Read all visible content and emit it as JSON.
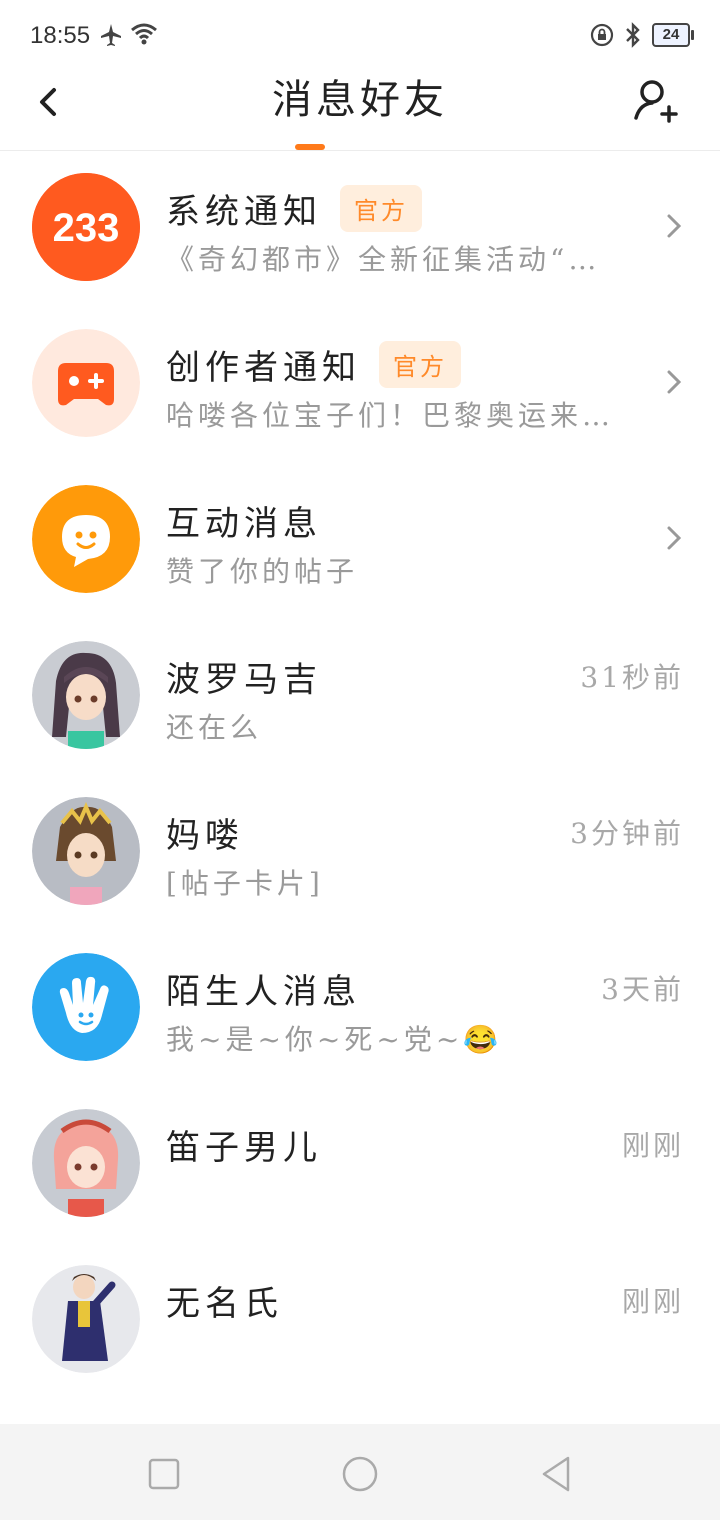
{
  "status_bar": {
    "time": "18:55",
    "battery": "24",
    "icons_left": [
      "airplane-icon",
      "wifi-icon"
    ],
    "icons_right": [
      "lock-rotation-icon",
      "bluetooth-icon",
      "battery-icon"
    ]
  },
  "header": {
    "title": "消息好友",
    "accent_color": "#ff7a1a"
  },
  "messages": [
    {
      "name": "系统通知",
      "badge": "官方",
      "preview": "《奇幻都市》全新征集活动“…",
      "time": "",
      "avatar": "233-logo",
      "avatar_text": "233",
      "avatar_color": "#ff4d1a"
    },
    {
      "name": "创作者通知",
      "badge": "官方",
      "preview": "哈喽各位宝子们！巴黎奥运来…",
      "time": "",
      "avatar": "gamepad-icon",
      "avatar_color": "#ffe9de"
    },
    {
      "name": "互动消息",
      "badge": "",
      "preview": "赞了你的帖子",
      "time": "",
      "avatar": "chat-smile-icon",
      "avatar_color": "#ff9a0a"
    },
    {
      "name": "波罗马吉",
      "badge": "",
      "preview": "还在么",
      "time": "31秒前",
      "avatar": "character-avatar-1"
    },
    {
      "name": "妈喽",
      "badge": "",
      "preview": "[帖子卡片]",
      "time": "3分钟前",
      "avatar": "character-avatar-2"
    },
    {
      "name": "陌生人消息",
      "badge": "",
      "preview": "我~是~你~死~党~😂",
      "time": "3天前",
      "avatar": "wave-hand-icon",
      "avatar_color": "#2aa8f0"
    },
    {
      "name": "笛子男儿",
      "badge": "",
      "preview": "",
      "time": "刚刚",
      "avatar": "character-avatar-3"
    },
    {
      "name": "无名氏",
      "badge": "",
      "preview": "",
      "time": "刚刚",
      "avatar": "character-avatar-4"
    }
  ],
  "nav": {
    "icons": [
      "recent-apps-icon",
      "home-icon",
      "back-nav-icon"
    ]
  }
}
